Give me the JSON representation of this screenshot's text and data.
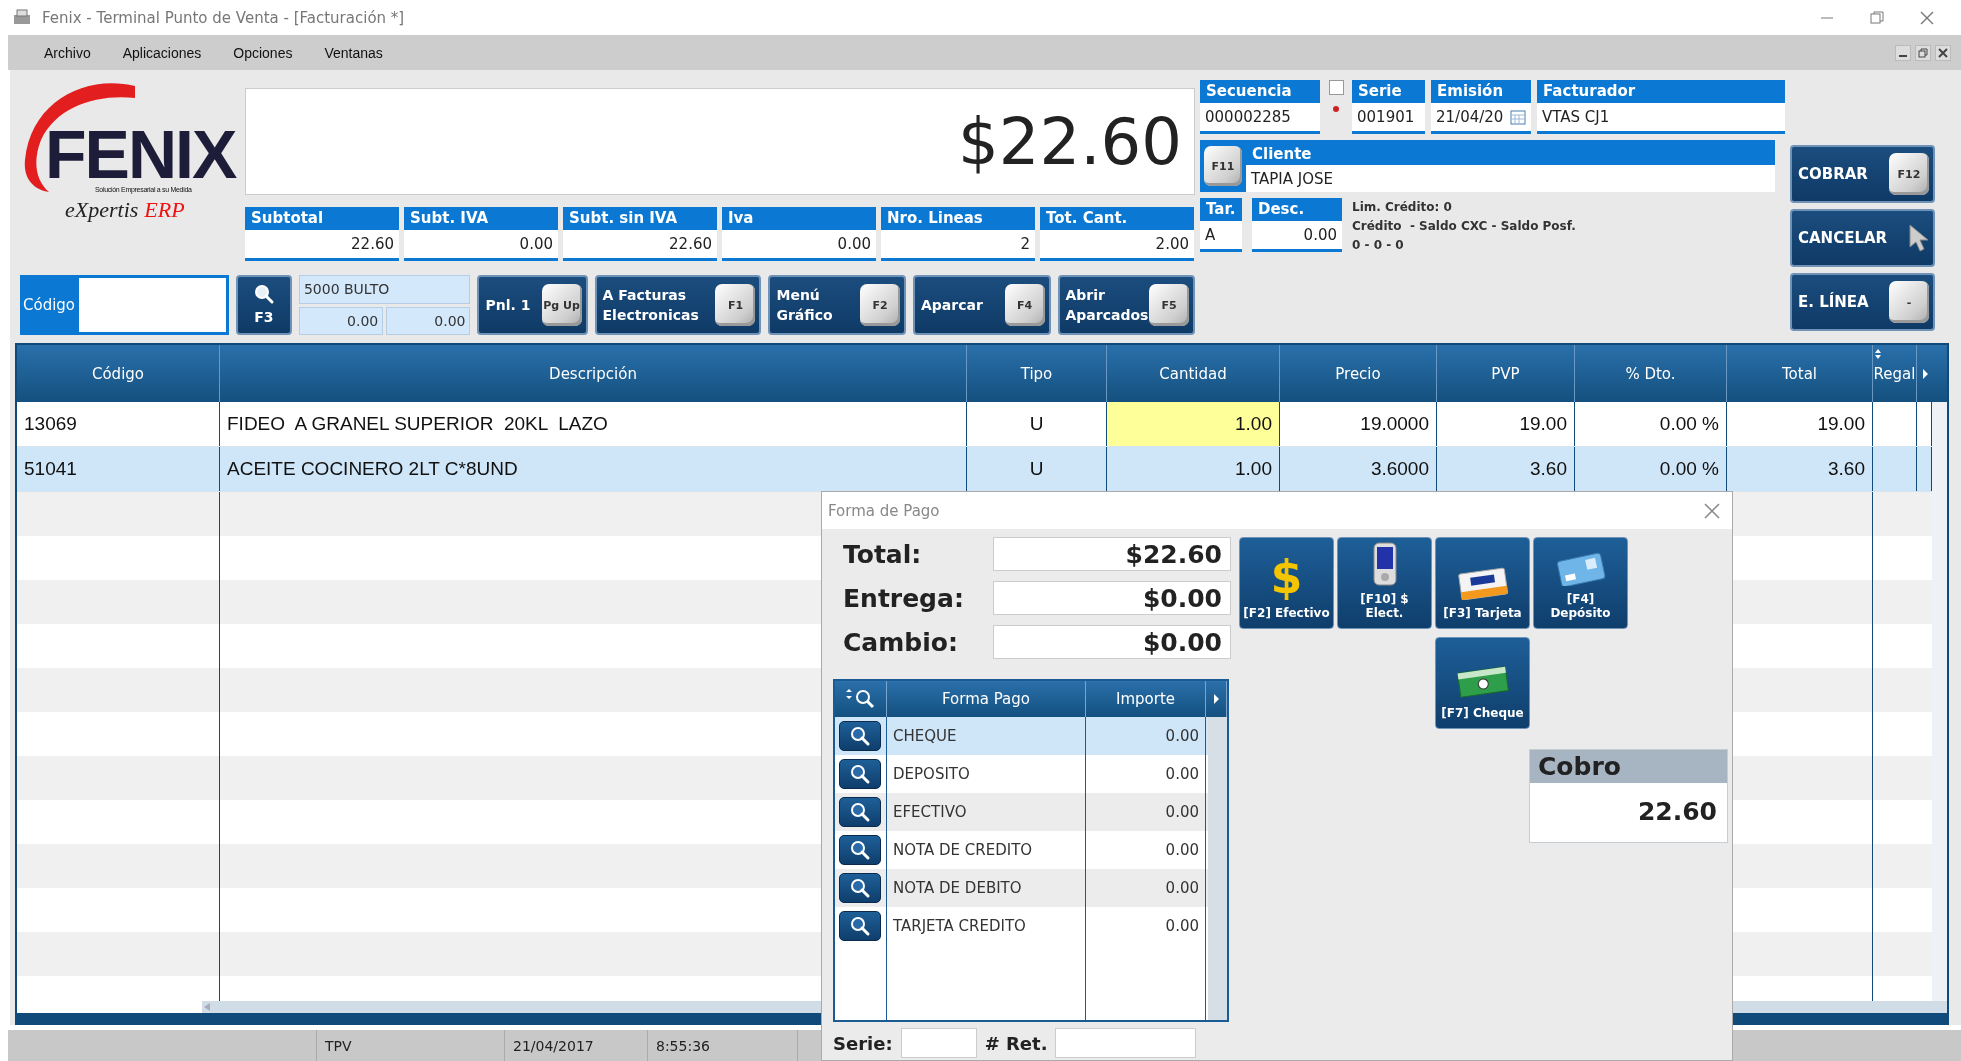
{
  "window": {
    "title": "Fenix - Terminal Punto de Venta - [Facturación *]"
  },
  "menu": [
    "Archivo",
    "Aplicaciones",
    "Opciones",
    "Ventanas"
  ],
  "logo": {
    "name": "FENIX",
    "tagline": "Solución Empresarial a su Medida",
    "brand": "eXpertis",
    "brand_suffix": "ERP"
  },
  "total_display": "$22.60",
  "totals": [
    {
      "label": "Subtotal",
      "value": "22.60"
    },
    {
      "label": "Subt. IVA",
      "value": "0.00"
    },
    {
      "label": "Subt. sin IVA",
      "value": "22.60"
    },
    {
      "label": "Iva",
      "value": "0.00"
    },
    {
      "label": "Nro. Lineas",
      "value": "2"
    },
    {
      "label": "Tot. Cant.",
      "value": "2.00"
    }
  ],
  "document": [
    {
      "label": "Secuencia",
      "value": "000002285",
      "kind": "sequence",
      "checked": false
    },
    {
      "label": "Serie",
      "value": "001901",
      "kind": "text"
    },
    {
      "label": "Emisión",
      "value": "21/04/20",
      "kind": "date"
    },
    {
      "label": "Facturador",
      "value": "VTAS CJ1",
      "kind": "text"
    }
  ],
  "cliente": {
    "key": "F11",
    "label": "Cliente",
    "value": "TAPIA JOSE"
  },
  "tarifa": {
    "label": "Tar.",
    "value": "A"
  },
  "descuento": {
    "label": "Desc.",
    "value": "0.00"
  },
  "credit_info": [
    "Lim. Crédito: 0",
    "Crédito  - Saldo CXC - Saldo Posf.",
    "0 - 0 - 0"
  ],
  "side_buttons": [
    {
      "label": "COBRAR",
      "key": "F12",
      "kind": "key"
    },
    {
      "label": "CANCELAR",
      "kind": "pointer"
    },
    {
      "label": "E. LÍNEA",
      "key": "-",
      "kind": "key"
    }
  ],
  "codigo": {
    "label": "Código"
  },
  "search_button": {
    "key": "F3"
  },
  "product_panel": {
    "name": "5000 BULTO",
    "values": [
      "0.00",
      "0.00"
    ]
  },
  "action_buttons": [
    {
      "label": "Pnl. 1",
      "key": "Pg Up"
    },
    {
      "label": "A Facturas Electronicas",
      "key": "F1"
    },
    {
      "label": "Menú Gráfico",
      "key": "F2"
    },
    {
      "label": "Aparcar",
      "key": "F4"
    },
    {
      "label": "Abrir Aparcados",
      "key": "F5"
    }
  ],
  "table": {
    "columns": [
      {
        "label": "Código",
        "kind": "text",
        "editable": false
      },
      {
        "label": "Descripción",
        "kind": "text",
        "editable": false
      },
      {
        "label": "Tipo",
        "kind": "flag",
        "editable": false
      },
      {
        "label": "Cantidad",
        "kind": "number",
        "editable": true
      },
      {
        "label": "Precio",
        "kind": "number",
        "editable": false
      },
      {
        "label": "PVP",
        "kind": "number",
        "editable": false
      },
      {
        "label": "% Dto.",
        "kind": "number",
        "editable": false
      },
      {
        "label": "Total",
        "kind": "number",
        "editable": false
      },
      {
        "label": "Regal",
        "kind": "flag",
        "editable": false
      }
    ],
    "rows": [
      {
        "cells": [
          "13069",
          "FIDEO  A GRANEL SUPERIOR  20KL  LAZO",
          "U",
          "1.00",
          "19.0000",
          "19.00",
          "0.00 %",
          "19.00"
        ],
        "selected": false,
        "focused": true
      },
      {
        "cells": [
          "51041",
          "ACEITE COCINERO 2LT C*8UND",
          "U",
          "1.00",
          "3.6000",
          "3.60",
          "0.00 %",
          "3.60"
        ],
        "selected": true,
        "focused": false
      }
    ]
  },
  "payment_dialog": {
    "title": "Forma de Pago",
    "summary": [
      {
        "label": "Total:",
        "value": "$22.60"
      },
      {
        "label": "Entrega:",
        "value": "$0.00"
      },
      {
        "label": "Cambio:",
        "value": "$0.00"
      }
    ],
    "methods": [
      {
        "label": "[F2] Efectivo",
        "kind": "cash",
        "glyph": "$"
      },
      {
        "label": "[F10] $ Elect.",
        "kind": "phone"
      },
      {
        "label": "[F3] Tarjeta",
        "kind": "card"
      },
      {
        "label": "[F4] Depósito",
        "kind": "deposit"
      },
      {
        "label": "[F7] Cheque",
        "kind": "cheque"
      }
    ],
    "columns": [
      "Forma Pago",
      "Importe"
    ],
    "rows": [
      {
        "name": "CHEQUE",
        "amount": "0.00",
        "selected": true
      },
      {
        "name": "DEPOSITO",
        "amount": "0.00",
        "selected": false
      },
      {
        "name": "EFECTIVO",
        "amount": "0.00",
        "selected": false
      },
      {
        "name": "NOTA DE CREDITO",
        "amount": "0.00",
        "selected": false
      },
      {
        "name": "NOTA DE DEBITO",
        "amount": "0.00",
        "selected": false
      },
      {
        "name": "TARJETA CREDITO",
        "amount": "0.00",
        "selected": false
      }
    ],
    "cobro": {
      "label": "Cobro",
      "value": "22.60"
    },
    "footer": [
      "Serie:",
      "# Ret."
    ]
  },
  "status_bar": [
    "TPV",
    "21/04/2017",
    "8:55:36"
  ]
}
